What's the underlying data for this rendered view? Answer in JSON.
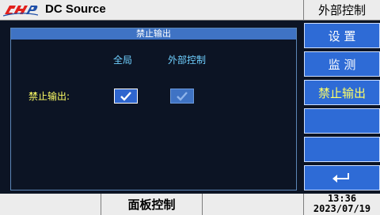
{
  "header": {
    "app_title": "DC Source",
    "mode": "外部控制"
  },
  "panel": {
    "title": "禁止输出",
    "col_all": "全局",
    "col_external": "外部控制",
    "row_label": "禁止输出:",
    "checkbox_all_checked": true,
    "checkbox_external_checked": true
  },
  "sidebar": {
    "items": [
      {
        "label": "设 置"
      },
      {
        "label": "监 测"
      },
      {
        "label": "禁止输出"
      },
      {
        "label": ""
      },
      {
        "label": ""
      },
      {
        "label": ""
      }
    ],
    "return_icon": "return-arrow-icon"
  },
  "footer": {
    "panel_control": "面板控制",
    "time": "13:36",
    "date": "2023/07/19"
  },
  "colors": {
    "button_blue": "#2e6bd6",
    "panel_title_blue": "#3f73c4",
    "highlight_yellow": "#ffff66",
    "column_label_cyan": "#6fd0ff",
    "background": "#0c1424"
  }
}
